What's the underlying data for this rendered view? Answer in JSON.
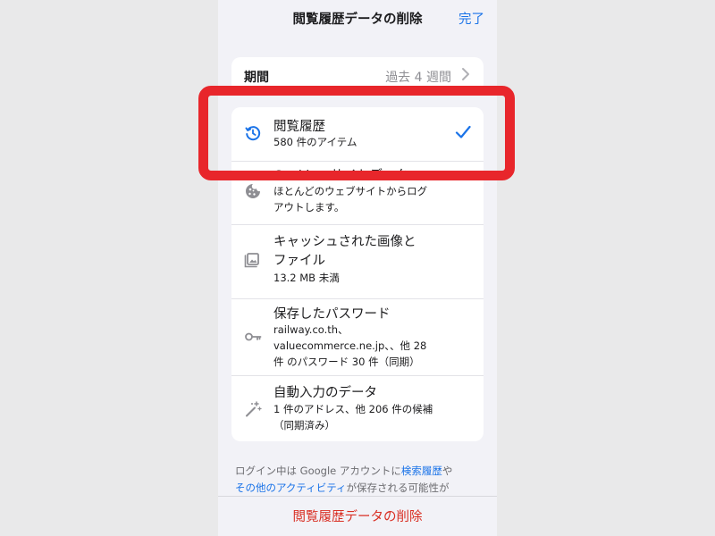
{
  "nav": {
    "title": "閲覧履歴データの削除",
    "done_label": "完了"
  },
  "period": {
    "label": "期間",
    "value": "過去 4 週間"
  },
  "items": [
    {
      "title": "閲覧履歴",
      "subtitle": "580 件のアイテム",
      "icon": "history-icon",
      "checked": true
    },
    {
      "title": "Cookie、サイトデータ",
      "subtitle_lines": [
        "ほとんどのウェブサイトからログ",
        "アウトします。"
      ],
      "icon": "cookie-icon"
    },
    {
      "title_lines": [
        "キャッシュされた画像と",
        "ファイル"
      ],
      "subtitle": "13.2 MB 未満",
      "icon": "image-icon"
    },
    {
      "title": "保存したパスワード",
      "subtitle_lines": [
        "railway.co.th、",
        "valuecommerce.ne.jp、、他 28",
        "件 のパスワード 30 件（同期）"
      ],
      "icon": "key-icon"
    },
    {
      "title": "自動入力のデータ",
      "subtitle_lines": [
        "1 件のアドレス、他 206 件の候補",
        "（同期済み）"
      ],
      "icon": "magic-wand-icon"
    }
  ],
  "footer": {
    "line1_prefix": "ログイン中は Google アカウントに",
    "line1_link": "検索履歴",
    "line1_suffix": "や",
    "line2_link": "その他のアクティビティ",
    "line2_suffix": "が保存される可能性が"
  },
  "bottom": {
    "delete_label": "閲覧履歴データの削除"
  },
  "colors": {
    "accent": "#1a73e8",
    "destructive": "#d93025",
    "highlight": "#e8262b",
    "background": "#f2f2f7"
  }
}
